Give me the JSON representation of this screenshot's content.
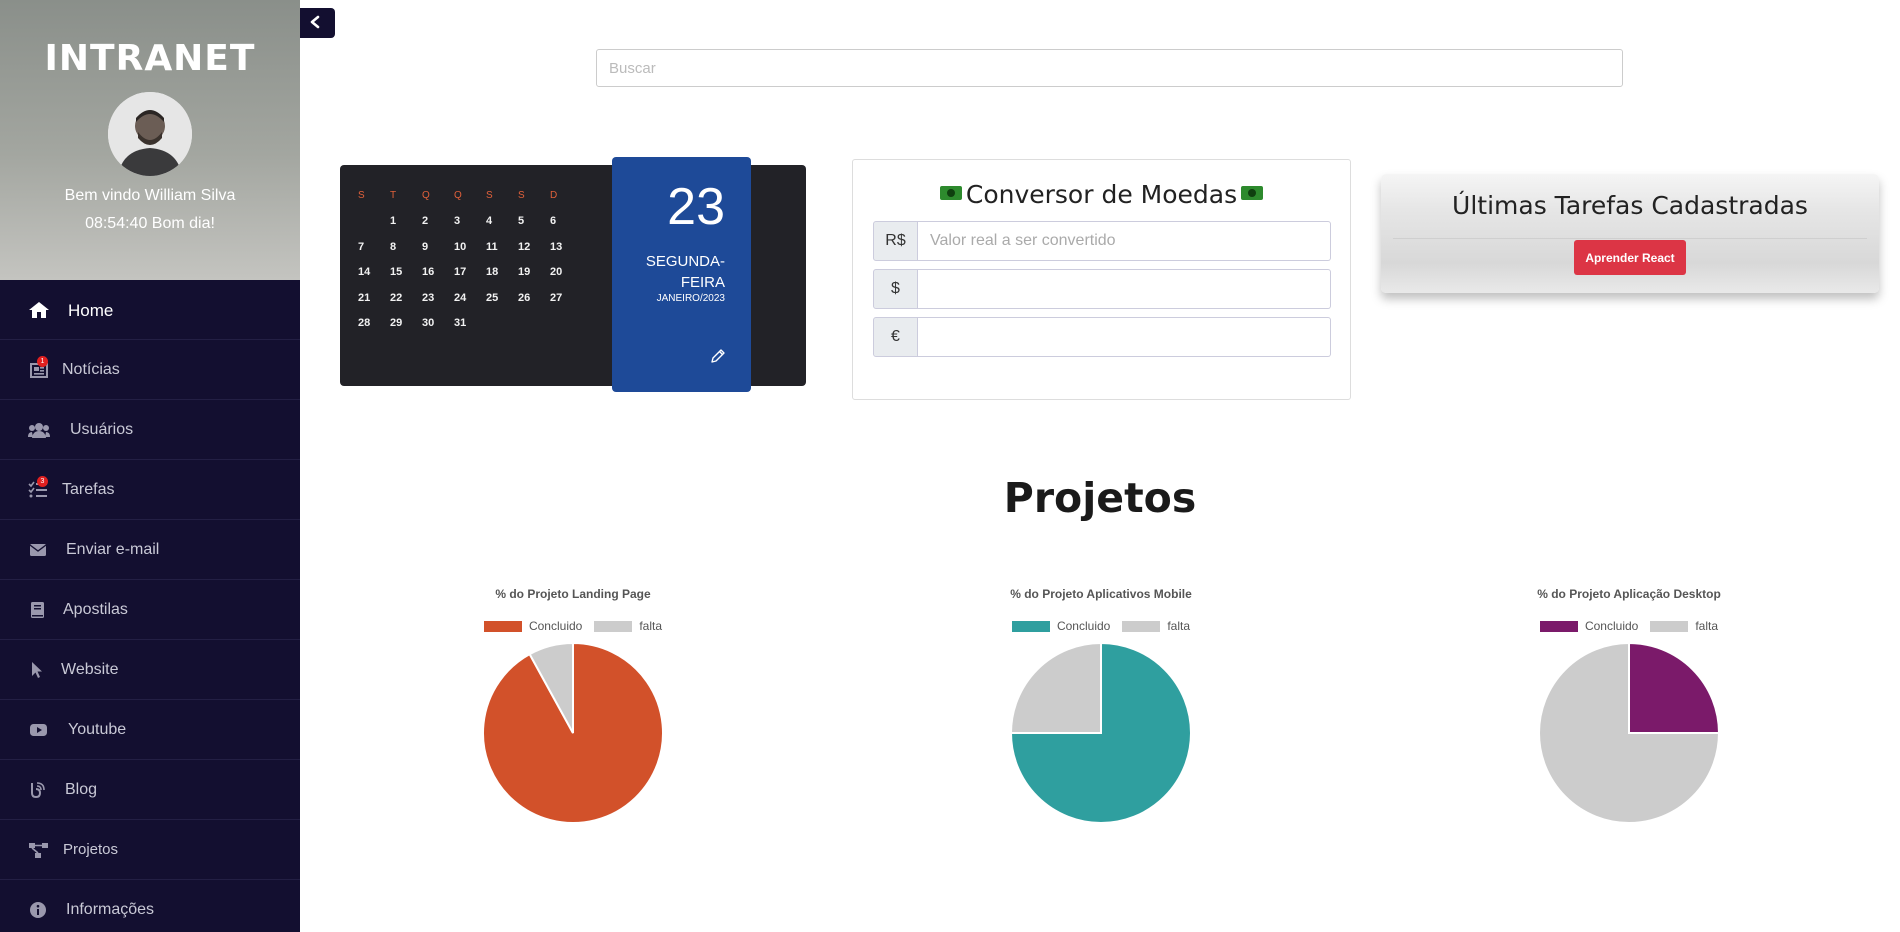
{
  "sidebar": {
    "logo": "INTRANET",
    "welcome": "Bem vindo William Silva",
    "clock": "08:54:40 Bom dia!",
    "items": [
      {
        "label": "Home",
        "icon": "home-icon",
        "active": true
      },
      {
        "label": "Notícias",
        "icon": "newspaper-icon",
        "badge": "1"
      },
      {
        "label": "Usuários",
        "icon": "users-icon"
      },
      {
        "label": "Tarefas",
        "icon": "tasks-icon",
        "badge": "3"
      },
      {
        "label": "Enviar e-mail",
        "icon": "envelope-icon"
      },
      {
        "label": "Apostilas",
        "icon": "book-icon"
      },
      {
        "label": "Website",
        "icon": "cursor-icon"
      },
      {
        "label": "Youtube",
        "icon": "youtube-icon"
      },
      {
        "label": "Blog",
        "icon": "blog-icon"
      },
      {
        "label": "Projetos",
        "icon": "project-diagram-icon"
      },
      {
        "label": "Informações",
        "icon": "info-icon"
      }
    ]
  },
  "search": {
    "placeholder": "Buscar"
  },
  "calendar": {
    "weekdays": [
      "S",
      "T",
      "Q",
      "Q",
      "S",
      "S",
      "D"
    ],
    "weeks": [
      [
        "",
        "1",
        "2",
        "3",
        "4",
        "5",
        "6"
      ],
      [
        "7",
        "8",
        "9",
        "10",
        "11",
        "12",
        "13"
      ],
      [
        "14",
        "15",
        "16",
        "17",
        "18",
        "19",
        "20"
      ],
      [
        "21",
        "22",
        "23",
        "24",
        "25",
        "26",
        "27"
      ],
      [
        "28",
        "29",
        "30",
        "31",
        "",
        "",
        ""
      ]
    ],
    "day": "23",
    "weekday_line1": "SEGUNDA-",
    "weekday_line2": "FEIRA",
    "month_year": "JANEIRO/2023"
  },
  "converter": {
    "title": "Conversor de Moedas",
    "rows": [
      {
        "symbol": "R$",
        "placeholder": "Valor real a ser convertido",
        "value": ""
      },
      {
        "symbol": "$",
        "placeholder": "",
        "value": ""
      },
      {
        "symbol": "€",
        "placeholder": "",
        "value": ""
      }
    ]
  },
  "tasks": {
    "title": "Últimas Tarefas Cadastradas",
    "items": [
      "Aprender React"
    ]
  },
  "projects": {
    "title": "Projetos"
  },
  "chart_data": [
    {
      "type": "pie",
      "title": "% do Projeto Landing Page",
      "categories": [
        "Concluido",
        "falta"
      ],
      "values": [
        92,
        8
      ],
      "colors": [
        "#d2512a",
        "#cccccc"
      ],
      "legend": "top"
    },
    {
      "type": "pie",
      "title": "% do Projeto Aplicativos Mobile",
      "categories": [
        "Concluido",
        "falta"
      ],
      "values": [
        75,
        25
      ],
      "colors": [
        "#2f9f9f",
        "#cccccc"
      ],
      "legend": "top"
    },
    {
      "type": "pie",
      "title": "% do Projeto Aplicação Desktop",
      "categories": [
        "Concluido",
        "falta"
      ],
      "values": [
        25,
        75
      ],
      "colors": [
        "#7b1a6a",
        "#cccccc"
      ],
      "legend": "top"
    }
  ]
}
